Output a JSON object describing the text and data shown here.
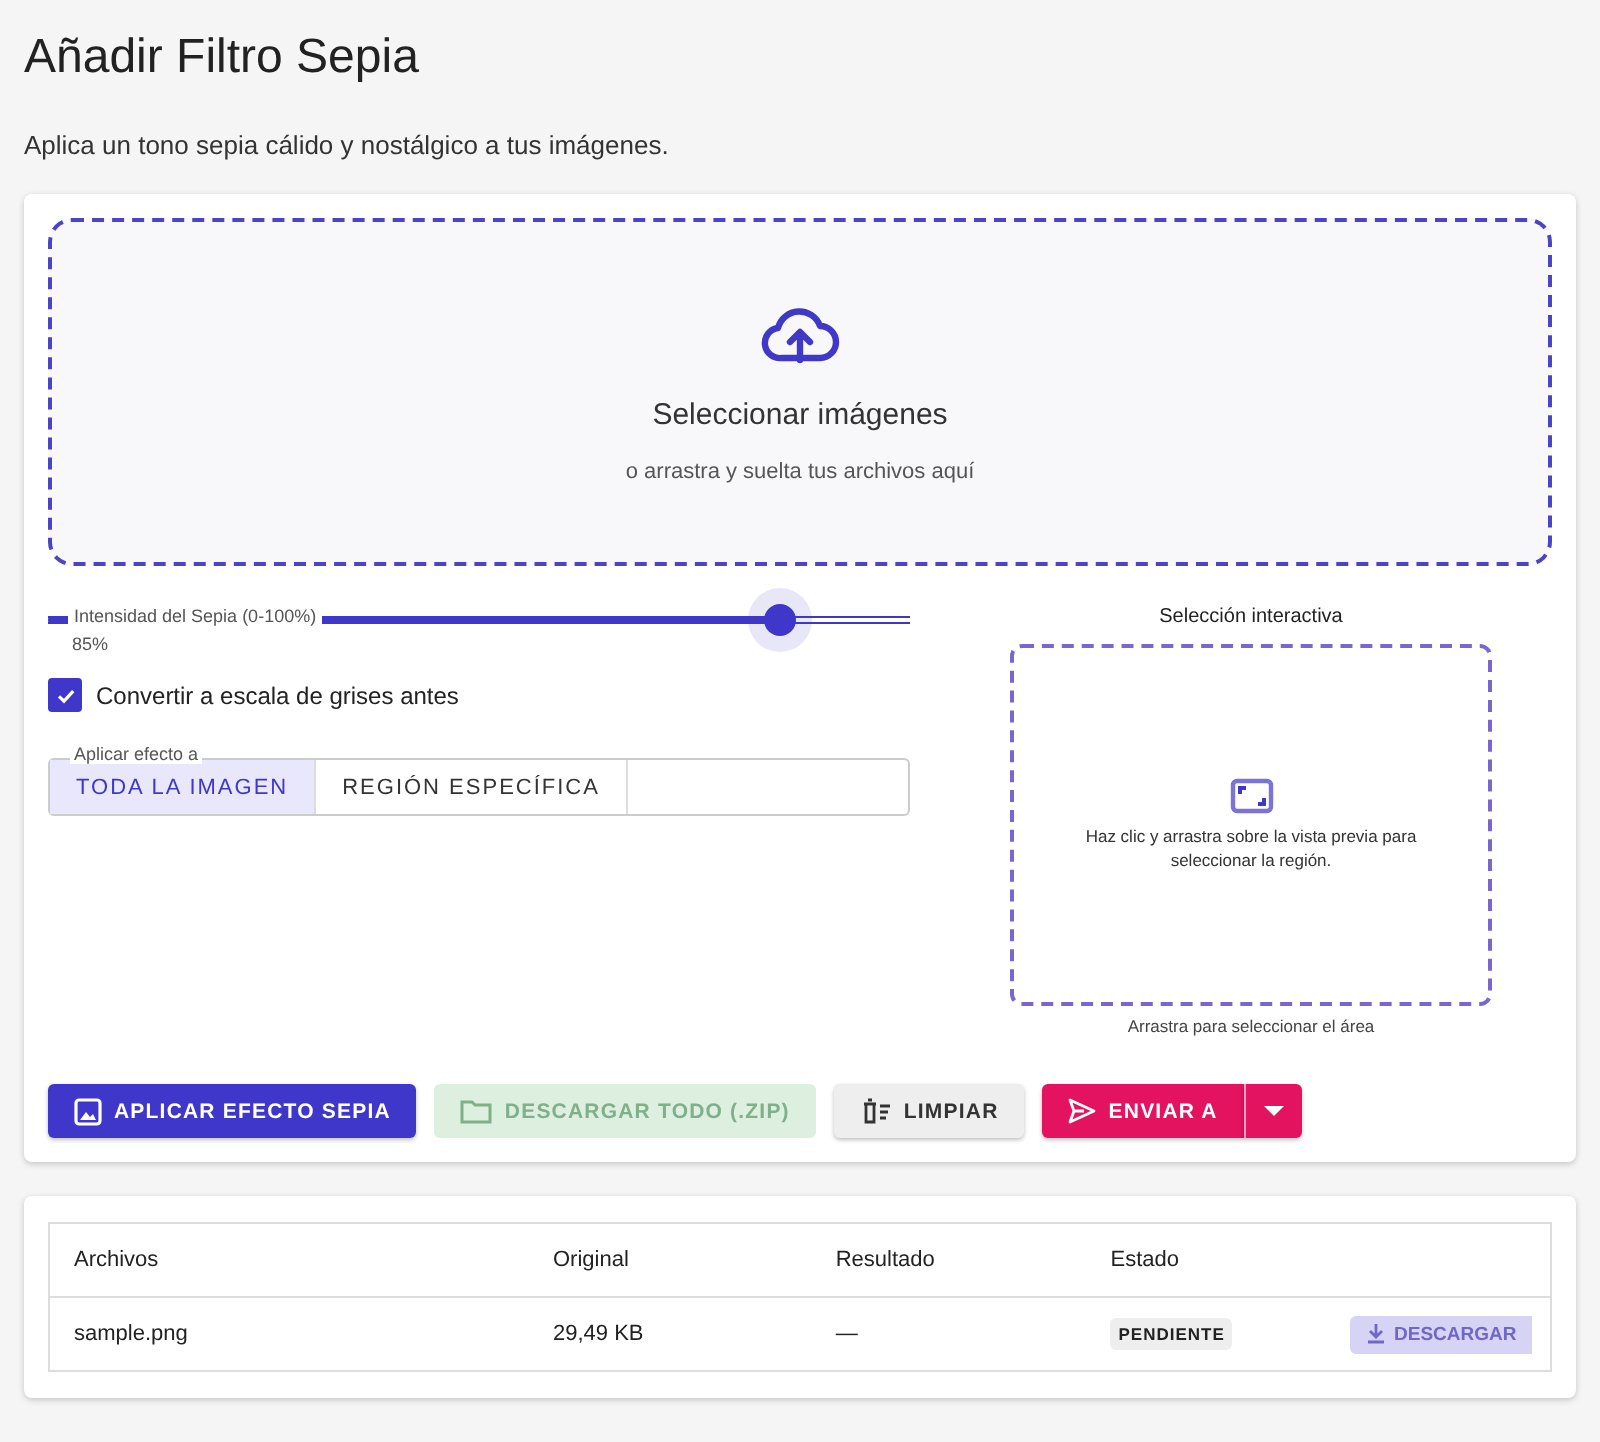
{
  "title": "Añadir Filtro Sepia",
  "subtitle": "Aplica un tono sepia cálido y nostálgico a tus imágenes.",
  "dropzone": {
    "title": "Seleccionar imágenes",
    "hint": "o arrastra y suelta tus archivos aquí"
  },
  "slider": {
    "label": "Intensidad del Sepia (0-100%)",
    "level": 0.85,
    "reading": "85%"
  },
  "checkbox": {
    "label": "Convertir a escala de grises antes",
    "checked": true
  },
  "apply_to": {
    "legend": "Aplicar efecto a",
    "options": [
      {
        "label": "TODA LA IMAGEN",
        "selected": true
      },
      {
        "label": "REGIÓN ESPECÍFICA",
        "selected": false
      }
    ]
  },
  "selection": {
    "title": "Selección interactiva",
    "hint": "Haz clic y arrastra sobre la vista previa para seleccionar la región.",
    "caption": "Arrastra para seleccionar el área"
  },
  "buttons": [
    {
      "kind": "primary",
      "label": "APLICAR EFECTO SEPIA",
      "disabled": false
    },
    {
      "kind": "download",
      "label": "DESCARGAR TODO (.ZIP)",
      "disabled": true
    },
    {
      "kind": "clear",
      "label": "LIMPIAR",
      "disabled": false
    },
    {
      "kind": "send",
      "label": "ENVIAR A",
      "disabled": false
    }
  ],
  "table": {
    "columns": [
      "Archivos",
      "Original",
      "Resultado",
      "Estado"
    ],
    "rows": [
      {
        "file": "sample.png",
        "original": "29,49 KB",
        "result": "—",
        "status": "PENDIENTE",
        "action": "DESCARGAR",
        "action_disabled": true
      }
    ]
  }
}
